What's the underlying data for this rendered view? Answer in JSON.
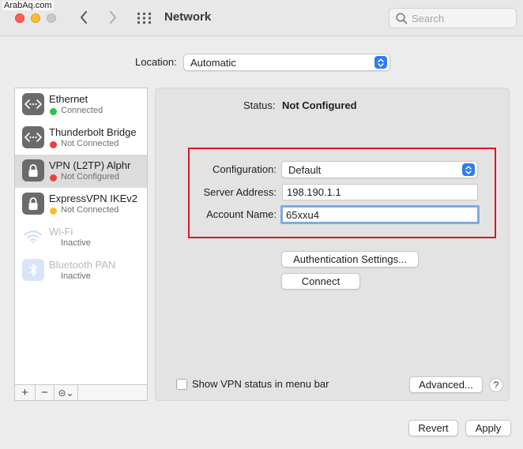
{
  "watermark": "ArabAq.com",
  "window": {
    "title": "Network"
  },
  "search": {
    "placeholder": "Search"
  },
  "location": {
    "label": "Location:",
    "value": "Automatic"
  },
  "services": [
    {
      "name": "Ethernet",
      "status": "Connected",
      "status_color": "green",
      "icon": "ethernet-icon",
      "selected": false,
      "enabled": true
    },
    {
      "name": "Thunderbolt Bridge",
      "status": "Not Connected",
      "status_color": "red",
      "icon": "ethernet-icon",
      "selected": false,
      "enabled": true
    },
    {
      "name": "VPN (L2TP) Alphr",
      "status": "Not Configured",
      "status_color": "red",
      "icon": "lock-icon",
      "selected": true,
      "enabled": true
    },
    {
      "name": "ExpressVPN IKEv2",
      "status": "Not Connected",
      "status_color": "yellow",
      "icon": "lock-icon",
      "selected": false,
      "enabled": true
    },
    {
      "name": "Wi-Fi",
      "status": "Inactive",
      "status_color": "",
      "icon": "wifi-icon",
      "selected": false,
      "enabled": false
    },
    {
      "name": "Bluetooth PAN",
      "status": "Inactive",
      "status_color": "",
      "icon": "bluetooth-icon",
      "selected": false,
      "enabled": false
    }
  ],
  "sidebar_footer": {
    "add": "+",
    "remove": "−",
    "action": "⊝⌄"
  },
  "detail": {
    "status_label": "Status:",
    "status_value": "Not Configured",
    "configuration_label": "Configuration:",
    "configuration_value": "Default",
    "server_address_label": "Server Address:",
    "server_address_value": "198.190.1.1",
    "account_name_label": "Account Name:",
    "account_name_value": "65xxu4",
    "auth_settings_button": "Authentication Settings...",
    "connect_button": "Connect",
    "show_vpn_status_label": "Show VPN status in menu bar",
    "advanced_button": "Advanced...",
    "help_button": "?"
  },
  "footer": {
    "revert_button": "Revert",
    "apply_button": "Apply"
  },
  "colors": {
    "accent": "#2f7cf6",
    "highlight_box": "#e0161c",
    "connected": "#2ec14b",
    "not_connected": "#e8413c",
    "warning": "#f6c02a"
  }
}
